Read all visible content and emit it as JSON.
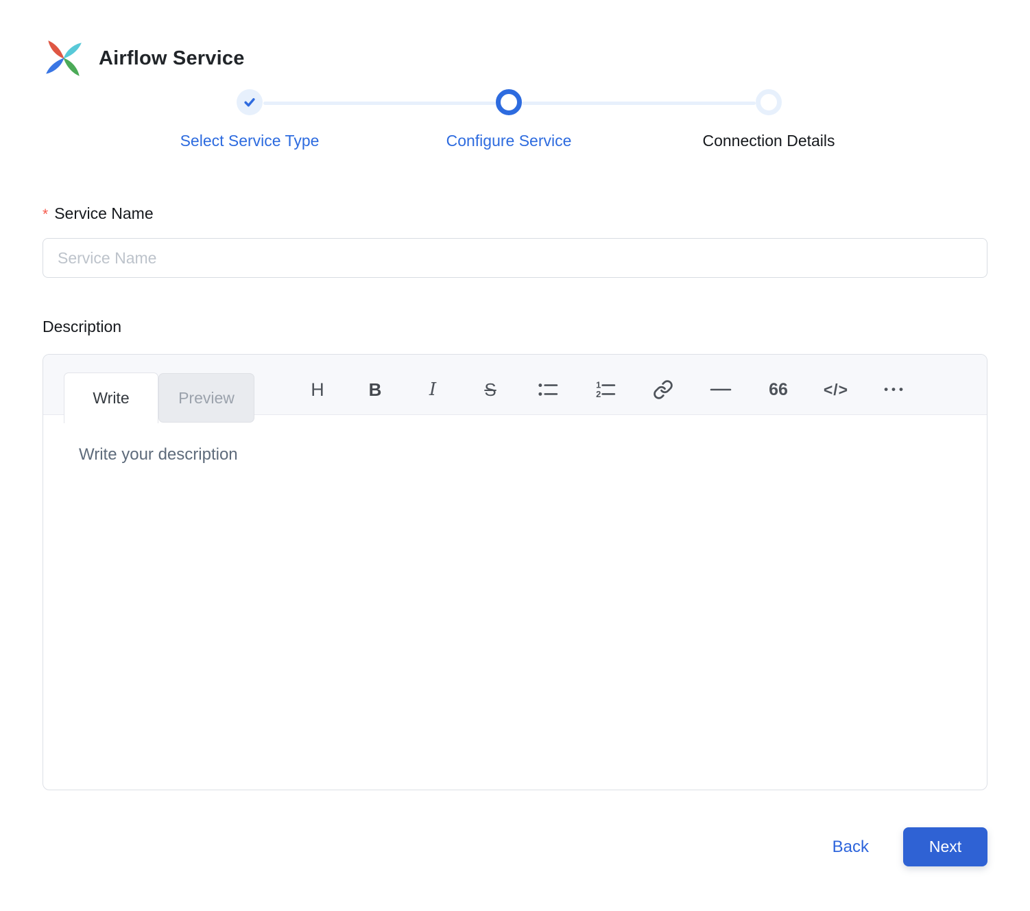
{
  "header": {
    "title": "Airflow Service"
  },
  "stepper": {
    "steps": [
      {
        "label": "Select Service Type",
        "state": "completed"
      },
      {
        "label": "Configure Service",
        "state": "active"
      },
      {
        "label": "Connection Details",
        "state": "pending"
      }
    ]
  },
  "form": {
    "service_name": {
      "required_marker": "*",
      "label": "Service Name",
      "placeholder": "Service Name",
      "value": ""
    },
    "description": {
      "label": "Description"
    }
  },
  "editor": {
    "tabs": {
      "write": "Write",
      "preview": "Preview"
    },
    "active_tab": "Write",
    "toolbar_glyphs": {
      "heading": "H",
      "bold": "B",
      "italic": "I",
      "strikethrough": "S",
      "quote": "66",
      "code": "</>",
      "more": "•••"
    },
    "placeholder": "Write your description",
    "content": ""
  },
  "footer": {
    "back_label": "Back",
    "next_label": "Next"
  },
  "colors": {
    "accent_blue": "#2d6bdf",
    "button_blue": "#2f62d4",
    "light_blue": "#e7f0fc",
    "required_red": "#f5584b"
  }
}
